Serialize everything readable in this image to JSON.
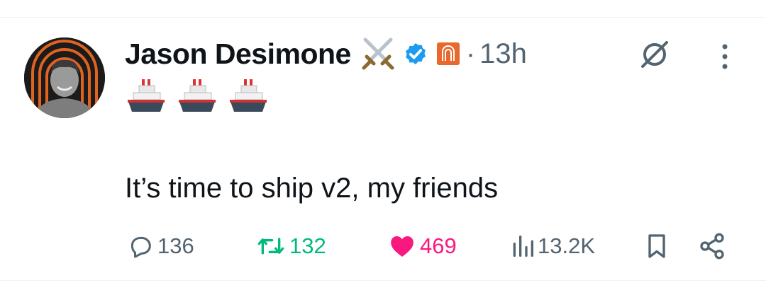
{
  "tweet": {
    "author_name": "Jason Desimone",
    "separator": "·",
    "time": "13h",
    "emoji": [
      "ship",
      "ship",
      "ship"
    ],
    "text": "It’s time to ship v2, my friends"
  },
  "icons": {
    "swords": "crossed-swords-icon",
    "verified": "verified-badge-icon",
    "affiliation": "affiliation-badge-icon",
    "grok": "grok-icon",
    "more": "more-dots-icon"
  },
  "actions": {
    "reply_count": "136",
    "retweet_count": "132",
    "like_count": "469",
    "view_count": "13.2K"
  },
  "colors": {
    "text": "#0f1419",
    "muted": "#536471",
    "verified": "#1d9bf0",
    "retweet": "#00ba7c",
    "like": "#f91880",
    "affiliation": "#e8682d"
  }
}
